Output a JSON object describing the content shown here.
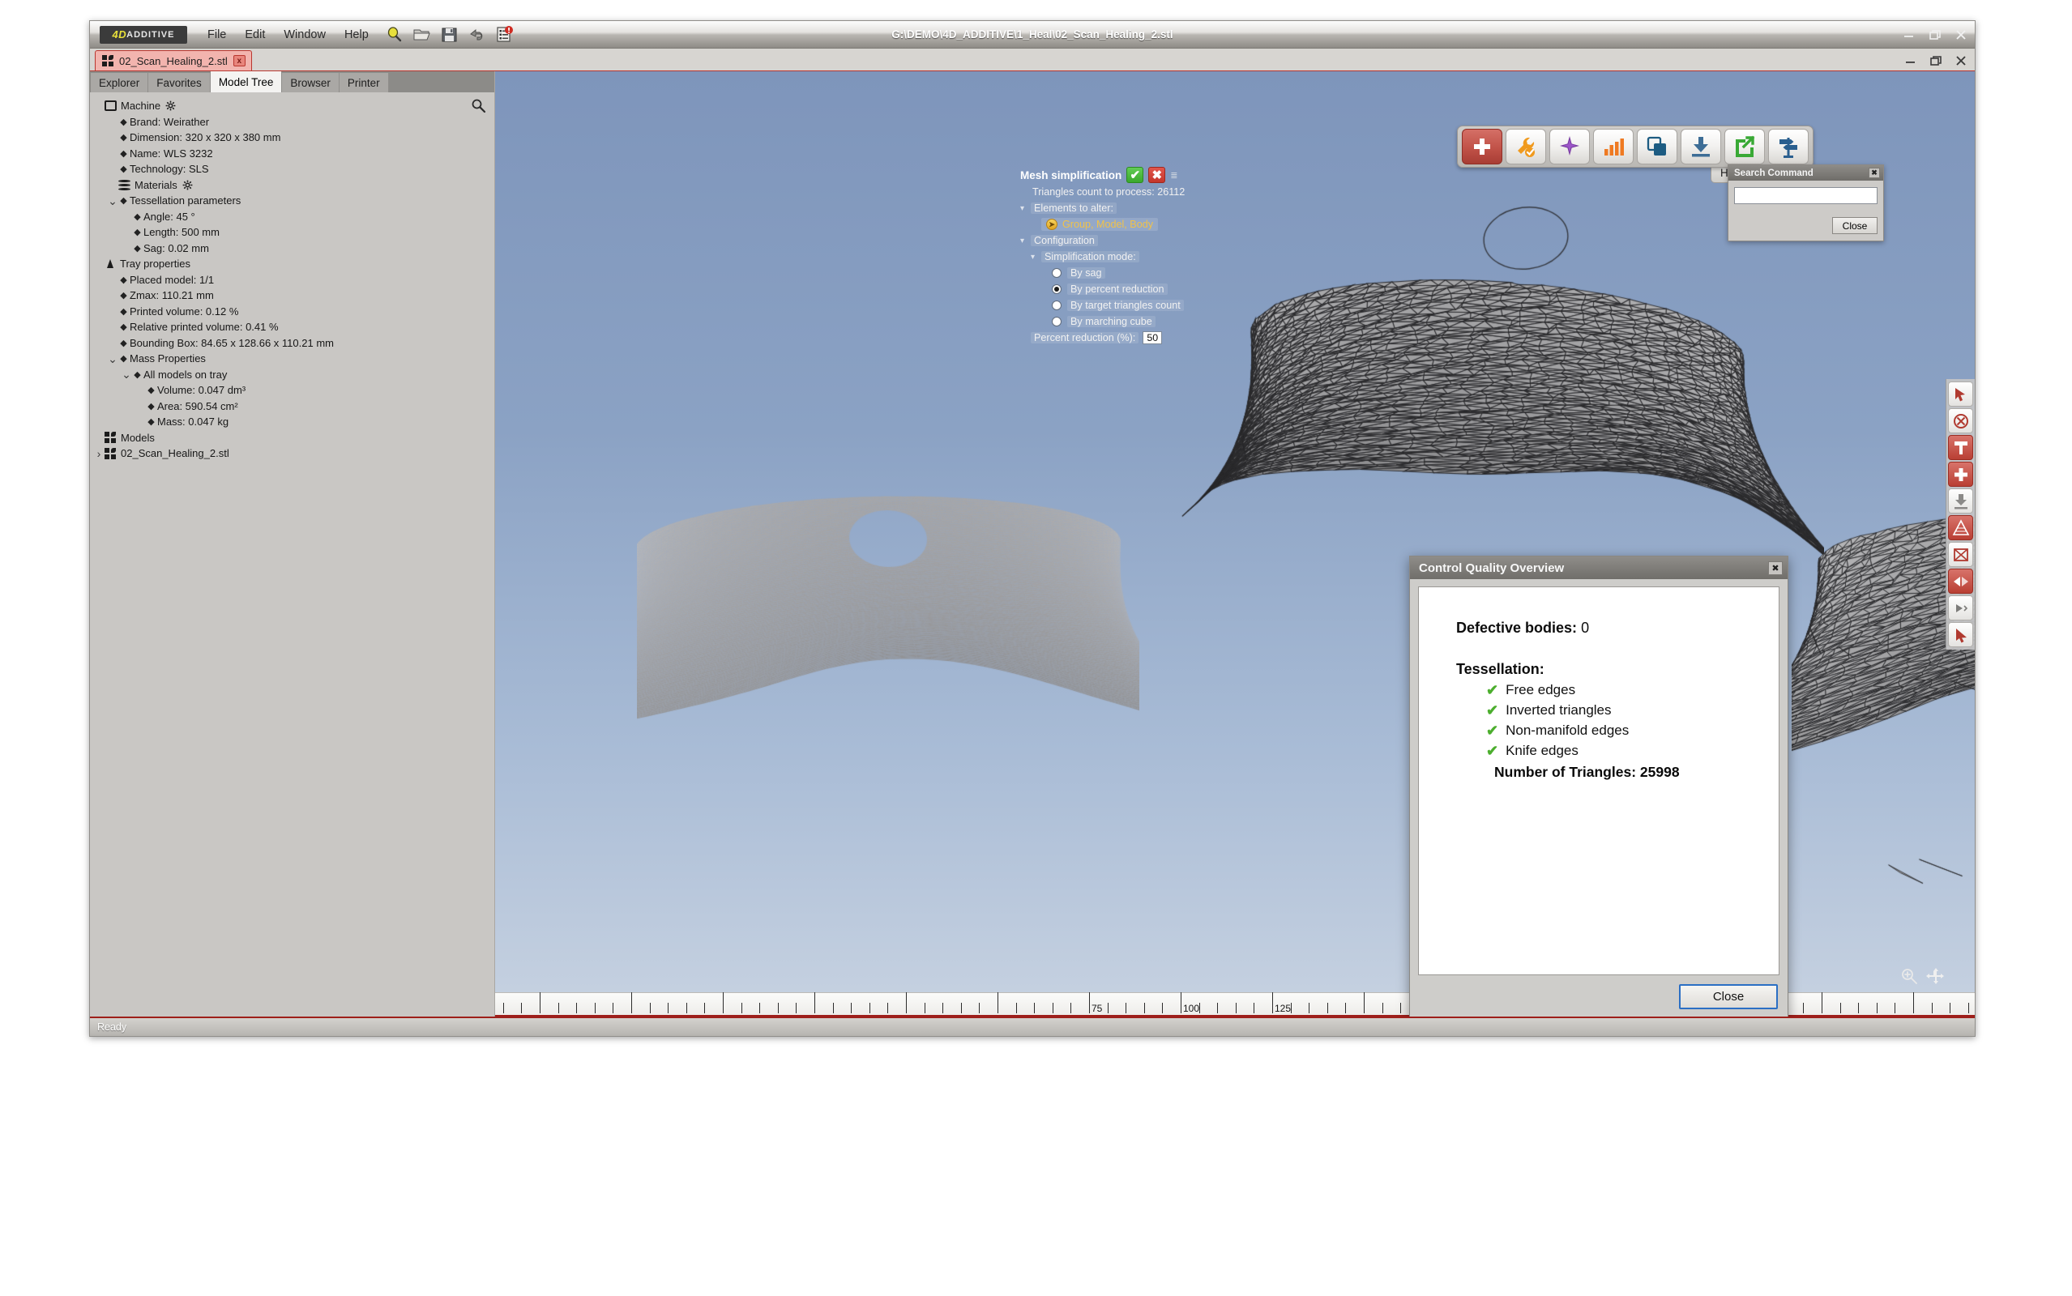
{
  "app": {
    "brand_4d": "4D",
    "brand_additive": "ADDITIVE",
    "window_title": "G:\\DEMO\\4D_ADDITIVE\\1_Heal\\02_Scan_Healing_2.stl",
    "menus": [
      "File",
      "Edit",
      "Window",
      "Help"
    ],
    "quick_icons": [
      "lightbulb-icon",
      "open-folder-icon",
      "save-icon",
      "undo-icon",
      "report-alert-icon"
    ],
    "window_buttons": [
      "minimize",
      "restore",
      "close"
    ]
  },
  "document_tab": {
    "label": "02_Scan_Healing_2.stl",
    "close_label": "x"
  },
  "panel_tabs": [
    {
      "label": "Explorer",
      "active": false
    },
    {
      "label": "Favorites",
      "active": false
    },
    {
      "label": "Model Tree",
      "active": true
    },
    {
      "label": "Browser",
      "active": false
    },
    {
      "label": "Printer",
      "active": false
    }
  ],
  "model_tree": [
    {
      "label": "Machine",
      "indent": 0,
      "icon": "monitor",
      "gear": true,
      "twisty": ""
    },
    {
      "label": "Brand: Weirather",
      "indent": 1,
      "icon": "diamond",
      "twisty": ""
    },
    {
      "label": "Dimension: 320 x 320 x 380 mm",
      "indent": 1,
      "icon": "diamond",
      "twisty": ""
    },
    {
      "label": "Name: WLS 3232",
      "indent": 1,
      "icon": "diamond",
      "twisty": ""
    },
    {
      "label": "Technology: SLS",
      "indent": 1,
      "icon": "diamond",
      "twisty": ""
    },
    {
      "label": "Materials",
      "indent": 1,
      "icon": "materials",
      "gear": true,
      "twisty": ""
    },
    {
      "label": "Tessellation parameters",
      "indent": 1,
      "icon": "diamond",
      "twisty": "v"
    },
    {
      "label": "Angle: 45 °",
      "indent": 2,
      "icon": "diamond",
      "twisty": ""
    },
    {
      "label": "Length: 500 mm",
      "indent": 2,
      "icon": "diamond",
      "twisty": ""
    },
    {
      "label": "Sag: 0.02 mm",
      "indent": 2,
      "icon": "diamond",
      "twisty": ""
    },
    {
      "label": "Tray properties",
      "indent": 0,
      "icon": "tray",
      "twisty": ""
    },
    {
      "label": "Placed model: 1/1",
      "indent": 1,
      "icon": "diamond",
      "twisty": ""
    },
    {
      "label": "Zmax: 110.21 mm",
      "indent": 1,
      "icon": "diamond",
      "twisty": ""
    },
    {
      "label": "Printed volume: 0.12 %",
      "indent": 1,
      "icon": "diamond",
      "twisty": ""
    },
    {
      "label": "Relative printed volume: 0.41 %",
      "indent": 1,
      "icon": "diamond",
      "twisty": ""
    },
    {
      "label": "Bounding Box: 84.65 x 128.66 x 110.21 mm",
      "indent": 1,
      "icon": "diamond",
      "twisty": ""
    },
    {
      "label": "Mass Properties",
      "indent": 1,
      "icon": "diamond",
      "twisty": "v"
    },
    {
      "label": "All models on tray",
      "indent": 2,
      "icon": "diamond",
      "twisty": "v"
    },
    {
      "label": "Volume: 0.047 dm³",
      "indent": 3,
      "icon": "diamond",
      "twisty": ""
    },
    {
      "label": "Area: 590.54 cm²",
      "indent": 3,
      "icon": "diamond",
      "twisty": ""
    },
    {
      "label": "Mass: 0.047 kg",
      "indent": 3,
      "icon": "diamond",
      "twisty": ""
    },
    {
      "label": "Models",
      "indent": 0,
      "icon": "models",
      "twisty": ""
    },
    {
      "label": "02_Scan_Healing_2.stl",
      "indent": 0,
      "icon": "models",
      "twisty": ">"
    }
  ],
  "mesh_simplification": {
    "title": "Mesh simplification",
    "accept_label": "✔",
    "reject_label": "✖",
    "menu_caret": "≣",
    "triangles_count": "Triangles count to process: 26112",
    "elements_to_alter_label": "Elements to alter:",
    "elements_value": "Group, Model, Body",
    "configuration_label": "Configuration",
    "simplification_mode_label": "Simplification mode:",
    "modes": [
      {
        "label": "By sag",
        "selected": false
      },
      {
        "label": "By percent reduction",
        "selected": true
      },
      {
        "label": "By target triangles count",
        "selected": false
      },
      {
        "label": "By marching cube",
        "selected": false
      }
    ],
    "percent_label": "Percent reduction (%):",
    "percent_value": "50"
  },
  "mode_toolbar": {
    "buttons": [
      {
        "name": "healing-icon",
        "glyph": "plus-cross",
        "active": true
      },
      {
        "name": "repair-tools-icon",
        "glyph": "wrench-check",
        "active": false
      },
      {
        "name": "optimize-icon",
        "glyph": "starburst",
        "active": false
      },
      {
        "name": "analysis-icon",
        "glyph": "bar-chart",
        "active": false
      },
      {
        "name": "duplicate-icon",
        "glyph": "layers",
        "active": false
      },
      {
        "name": "import-icon",
        "glyph": "download",
        "active": false
      },
      {
        "name": "export-icon",
        "glyph": "export-arrow",
        "active": false
      },
      {
        "name": "support-icon",
        "glyph": "signpost",
        "active": false
      }
    ],
    "active_tab_label": "Healing"
  },
  "right_toolbar": [
    {
      "name": "select-arrow-icon",
      "hot": false
    },
    {
      "name": "deselect-icon",
      "hot": false
    },
    {
      "name": "fill-hole-icon",
      "hot": true
    },
    {
      "name": "add-patch-icon",
      "hot": true
    },
    {
      "name": "flatten-icon",
      "hot": false
    },
    {
      "name": "remesh-icon",
      "hot": true
    },
    {
      "name": "delete-face-icon",
      "hot": false
    },
    {
      "name": "flip-normal-icon",
      "hot": true
    },
    {
      "name": "play-step-icon",
      "hot": false
    },
    {
      "name": "pointer-tool-icon",
      "hot": false
    }
  ],
  "search_command": {
    "title": "Search Command",
    "close_x": "✖",
    "input_value": "",
    "input_placeholder": "",
    "close_label": "Close"
  },
  "control_quality": {
    "title": "Control Quality Overview",
    "close_x": "✖",
    "defective_label": "Defective bodies:",
    "defective_value": "0",
    "tessellation_label": "Tessellation:",
    "checks": [
      {
        "label": "Free edges",
        "ok": true
      },
      {
        "label": "Inverted triangles",
        "ok": true
      },
      {
        "label": "Non-manifold edges",
        "ok": true
      },
      {
        "label": "Knife edges",
        "ok": true
      }
    ],
    "triangles_label": "Number of Triangles: 25998",
    "close_label": "Close"
  },
  "ruler": {
    "labels": [
      "75",
      "100",
      "125"
    ],
    "label_positions": [
      733,
      846,
      959
    ],
    "unit": "mm"
  },
  "statusbar": {
    "text": "Ready"
  },
  "colors": {
    "accent_red": "#b9362f",
    "viewport_bg_top": "#7e95bb",
    "viewport_bg_bottom": "#c7d2e1",
    "panel_bg": "#c9c7c4",
    "check_green": "#4cae2e",
    "highlight_yellow": "#f0c24a"
  }
}
